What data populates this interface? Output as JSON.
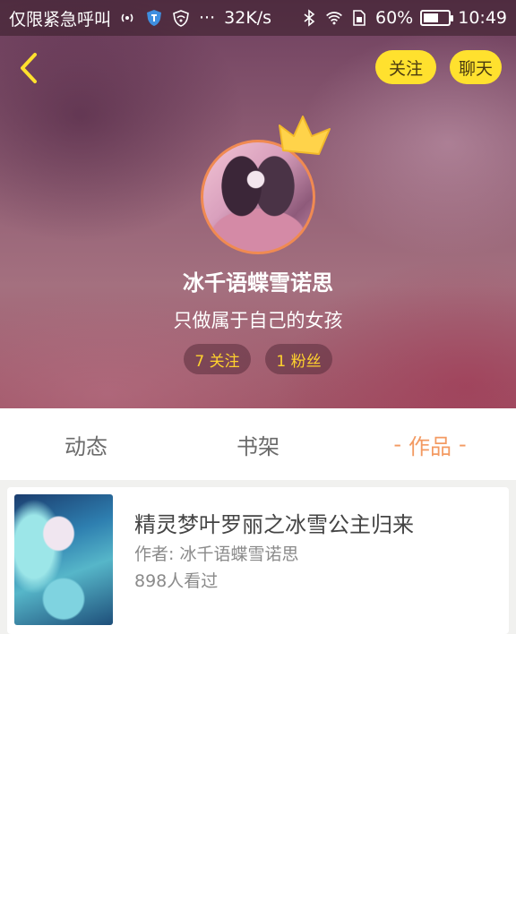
{
  "status_bar": {
    "carrier": "仅限紧急呼叫",
    "speed": "32K/s",
    "battery": "60%",
    "battery_level": 0.6,
    "time": "10:49",
    "icons": [
      "signal-broadcast-icon",
      "shield-icon",
      "vpn-icon",
      "more-dots-icon",
      "bluetooth-icon",
      "wifi-icon",
      "sim-icon",
      "battery-icon"
    ]
  },
  "header": {
    "back_icon": "chevron-left-icon",
    "follow_label": "关注",
    "chat_label": "聊天",
    "accent_color": "#ffe12e"
  },
  "profile": {
    "name": "冰千语蝶雪诺思",
    "bio": "只做属于自己的女孩",
    "following": "7 关注",
    "fans": "1 粉丝",
    "avatar_border_color": "#f08a52"
  },
  "tabs": [
    {
      "label": "动态"
    },
    {
      "label": "书架"
    },
    {
      "label": "作品",
      "active_prefix": "-",
      "active_suffix": "-"
    }
  ],
  "tab_active_color": "#f39a62",
  "works": [
    {
      "title": "精灵梦叶罗丽之冰雪公主归来",
      "author": "作者: 冰千语蝶雪诺思",
      "views": "898人看过"
    }
  ]
}
